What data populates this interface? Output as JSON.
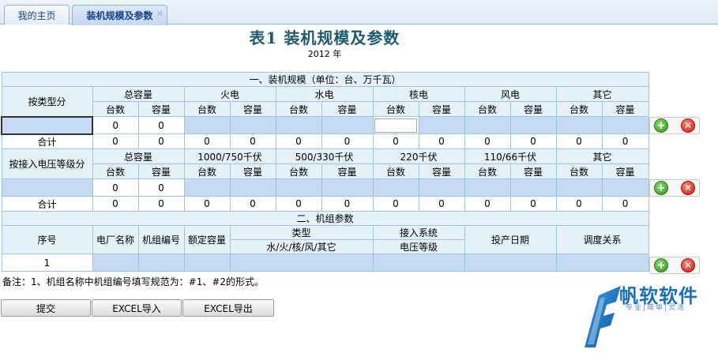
{
  "tabs": [
    {
      "label": "我的主页"
    },
    {
      "label": "装机规模及参数"
    }
  ],
  "report": {
    "title": "表1  装机规模及参数",
    "year": "2012 年"
  },
  "section1": {
    "heading": "一、装机规模（单位：台、万千瓦）",
    "by_type": {
      "row_label": "按类型分",
      "groups": [
        "总容量",
        "火电",
        "水电",
        "核电",
        "风电",
        "其它"
      ],
      "sub_headers": [
        "台数",
        "容量"
      ],
      "entry_values": [
        "0",
        "0"
      ],
      "total_label": "合计",
      "totals": [
        "0",
        "0",
        "0",
        "0",
        "0",
        "0",
        "0",
        "0",
        "0",
        "0",
        "0",
        "0"
      ]
    },
    "by_voltage": {
      "row_label": "按接入电压等级分",
      "groups": [
        "总容量",
        "1000/750千伏",
        "500/330千伏",
        "220千伏",
        "110/66千伏",
        "其它"
      ],
      "sub_headers": [
        "台数",
        "容量"
      ],
      "entry_values": [
        "0",
        "0"
      ],
      "total_label": "合计",
      "totals": [
        "0",
        "0",
        "0",
        "0",
        "0",
        "0",
        "0",
        "0",
        "0",
        "0",
        "0",
        "0"
      ]
    }
  },
  "section2": {
    "heading": "二、机组参数",
    "headers": {
      "seq": "序号",
      "plant": "电厂名称",
      "unit_no": "机组编号",
      "rated": "额定容量",
      "type": "类型",
      "type_sub": "水/火/核/风/其它",
      "grid": "接入系统",
      "grid_sub": "电压等级",
      "date": "投产日期",
      "dispatch": "调度关系"
    },
    "row_seq": "1"
  },
  "note": "备注：1、机组名称中机组编号填写规范为：#1、#2的形式。",
  "buttons": {
    "submit": "提交",
    "import": "EXCEL导入",
    "export": "EXCEL导出"
  },
  "logo": {
    "name": "帆软软件",
    "tagline": "专业|简单|灵活"
  },
  "colors": {
    "header_bg": "#e5f1f9",
    "input_bg": "#c7daf5",
    "border": "#9cc6d9",
    "title": "#1f5a6e",
    "brand": "#1b6fb5"
  }
}
